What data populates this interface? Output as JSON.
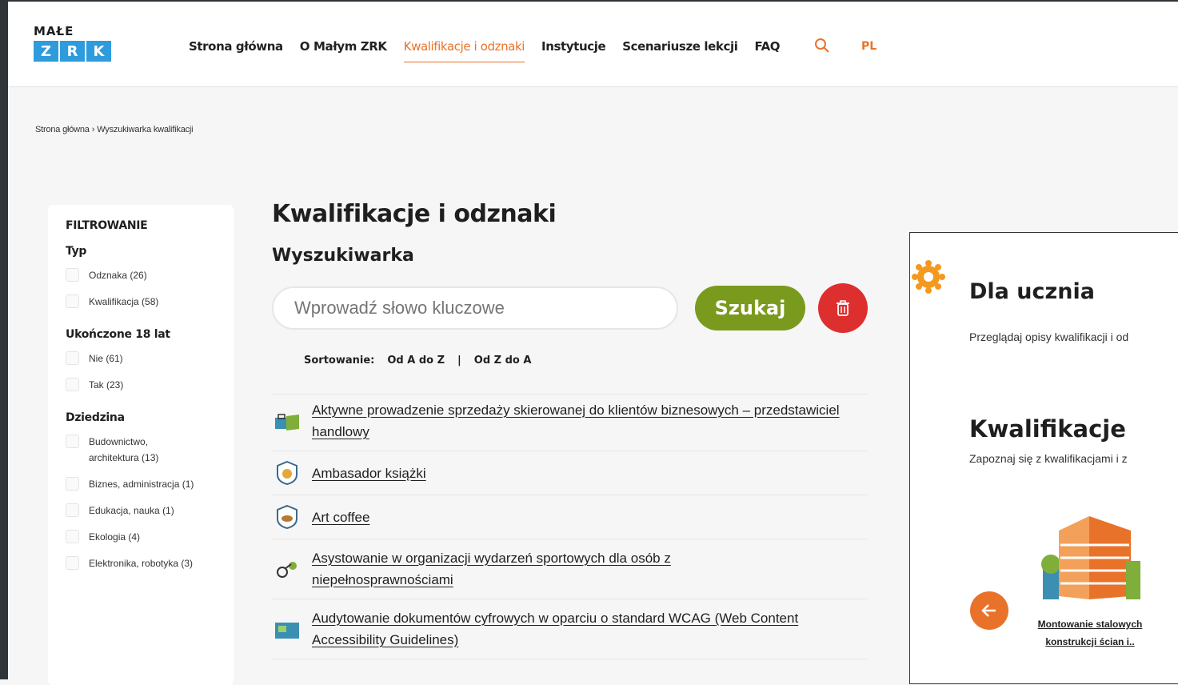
{
  "header": {
    "logo_top": "MAŁE",
    "logo_letters": [
      "Z",
      "R",
      "K"
    ],
    "nav": [
      {
        "label": "Strona główna",
        "active": false
      },
      {
        "label": "O Małym ZRK",
        "active": false
      },
      {
        "label": "Kwalifikacje i odznaki",
        "active": true
      },
      {
        "label": "Instytucje",
        "active": false
      },
      {
        "label": "Scenariusze lekcji",
        "active": false
      },
      {
        "label": "FAQ",
        "active": false
      }
    ],
    "search_icon": "search-icon",
    "lang": "PL"
  },
  "breadcrumb": {
    "home": "Strona główna",
    "sep": "›",
    "current": "Wyszukiwarka kwalifikacji"
  },
  "filters": {
    "title": "FILTROWANIE",
    "groups": [
      {
        "name": "Typ",
        "options": [
          "Odznaka (26)",
          "Kwalifikacja (58)"
        ]
      },
      {
        "name": "Ukończone 18 lat",
        "options": [
          "Nie (61)",
          "Tak (23)"
        ]
      },
      {
        "name": "Dziedzina",
        "options": [
          "Budownictwo, architektura (13)",
          "Biznes, administracja (1)",
          "Edukacja, nauka (1)",
          "Ekologia (4)",
          "Elektronika, robotyka (3)"
        ]
      }
    ]
  },
  "main": {
    "title": "Kwalifikacje i odznaki",
    "subtitle": "Wyszukiwarka",
    "search_placeholder": "Wprowadź słowo kluczowe",
    "search_button": "Szukaj",
    "sort_label": "Sortowanie:",
    "sort_az": "Od A do Z",
    "sort_sep": "|",
    "sort_za": "Od Z do A",
    "results": [
      "Aktywne prowadzenie sprzedaży skierowanej do klientów biznesowych – przedstawiciel handlowy",
      "Ambasador książki",
      "Art coffee",
      "Asystowanie w organizacji wydarzeń sportowych dla osób z niepełnosprawnościami",
      "Audytowanie dokumentów cyfrowych w oparciu o standard WCAG (Web Content Accessibility Guidelines)"
    ]
  },
  "side_panel": {
    "heading": "Dla ucznia",
    "text": "Przeglądaj opisy kwalifikacji i od",
    "section": "Kwalifikacje",
    "section_text": "Zapoznaj się z kwalifikacjami i z",
    "card_label": "Montowanie stalowych konstrukcji ścian i..",
    "accent": "#e9722a"
  },
  "colors": {
    "accent": "#e9722a",
    "brand": "#2e9bdc",
    "search_btn": "#7a9a1e",
    "clear_btn": "#de2f2f"
  }
}
